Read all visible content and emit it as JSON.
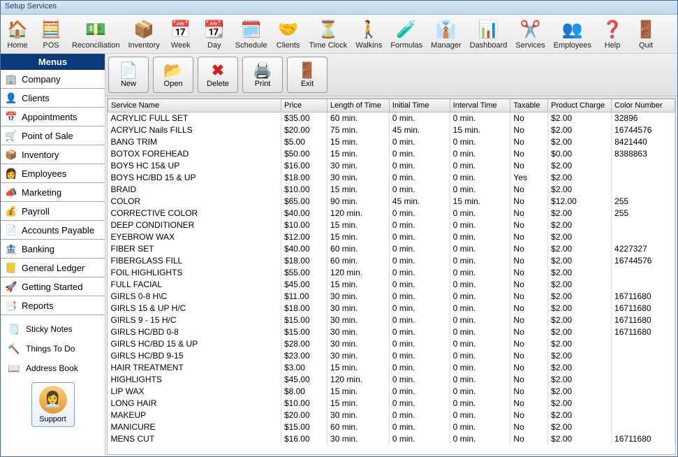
{
  "window": {
    "title": "Setup Services"
  },
  "toolbar": [
    {
      "name": "home",
      "label": "Home",
      "icon": "🏠"
    },
    {
      "name": "pos",
      "label": "POS",
      "icon": "🧮"
    },
    {
      "name": "reconciliation",
      "label": "Reconciliation",
      "icon": "💵"
    },
    {
      "name": "inventory",
      "label": "Inventory",
      "icon": "📦"
    },
    {
      "name": "week",
      "label": "Week",
      "icon": "📅"
    },
    {
      "name": "day",
      "label": "Day",
      "icon": "📆"
    },
    {
      "name": "schedule",
      "label": "Schedule",
      "icon": "🗓️"
    },
    {
      "name": "clients",
      "label": "Clients",
      "icon": "🤝"
    },
    {
      "name": "timeclock",
      "label": "Time Clock",
      "icon": "⏳"
    },
    {
      "name": "walkins",
      "label": "Walkins",
      "icon": "🚶"
    },
    {
      "name": "formulas",
      "label": "Formulas",
      "icon": "🧪"
    },
    {
      "name": "manager",
      "label": "Manager",
      "icon": "👔"
    },
    {
      "name": "dashboard",
      "label": "Dashboard",
      "icon": "📊"
    },
    {
      "name": "services",
      "label": "Services",
      "icon": "✂️"
    },
    {
      "name": "employees",
      "label": "Employees",
      "icon": "👥"
    },
    {
      "name": "help",
      "label": "Help",
      "icon": "❓"
    },
    {
      "name": "quit",
      "label": "Quit",
      "icon": "🚪"
    }
  ],
  "sidebar": {
    "header": "Menus",
    "items": [
      {
        "name": "company",
        "label": "Company",
        "icon": "🏢"
      },
      {
        "name": "clients",
        "label": "Clients",
        "icon": "👤"
      },
      {
        "name": "appointments",
        "label": "Appointments",
        "icon": "📅"
      },
      {
        "name": "pos",
        "label": "Point of Sale",
        "icon": "🛒"
      },
      {
        "name": "inventory",
        "label": "Inventory",
        "icon": "📦"
      },
      {
        "name": "employees",
        "label": "Employees",
        "icon": "👩"
      },
      {
        "name": "marketing",
        "label": "Marketing",
        "icon": "📣"
      },
      {
        "name": "payroll",
        "label": "Payroll",
        "icon": "💰"
      },
      {
        "name": "accounts-payable",
        "label": "Accounts Payable",
        "icon": "📄"
      },
      {
        "name": "banking",
        "label": "Banking",
        "icon": "🏦"
      },
      {
        "name": "general-ledger",
        "label": "General Ledger",
        "icon": "📒"
      },
      {
        "name": "getting-started",
        "label": "Getting Started",
        "icon": "🚀"
      },
      {
        "name": "reports",
        "label": "Reports",
        "icon": "📑"
      }
    ],
    "utils": [
      {
        "name": "sticky-notes",
        "label": "Sticky Notes",
        "icon": "🗒️"
      },
      {
        "name": "things-to-do",
        "label": "Things To Do",
        "icon": "🔨"
      },
      {
        "name": "address-book",
        "label": "Address Book",
        "icon": "📖"
      }
    ],
    "support": {
      "label": "Support"
    }
  },
  "actions": [
    {
      "name": "new",
      "label": "New",
      "icon": "📄"
    },
    {
      "name": "open",
      "label": "Open",
      "icon": "📂"
    },
    {
      "name": "delete",
      "label": "Delete",
      "icon": "✖"
    },
    {
      "name": "print",
      "label": "Print",
      "icon": "🖨️"
    },
    {
      "name": "exit",
      "label": "Exit",
      "icon": "🚪"
    }
  ],
  "table": {
    "headers": [
      "Service Name",
      "Price",
      "Length of Time",
      "Initial Time",
      "Interval Time",
      "Taxable",
      "Product Charge",
      "Color Number"
    ],
    "rows": [
      {
        "name": "ACRYLIC FULL SET",
        "price": "$35.00",
        "len": "60 min.",
        "init": "0 min.",
        "intv": "0 min.",
        "tax": "No",
        "prod": "$2.00",
        "color": "32896"
      },
      {
        "name": "ACRYLIC Nails FILLS",
        "price": "$20.00",
        "len": "75 min.",
        "init": "45 min.",
        "intv": "15 min.",
        "tax": "No",
        "prod": "$2.00",
        "color": "16744576"
      },
      {
        "name": "BANG TRIM",
        "price": "$5.00",
        "len": "15 min.",
        "init": "0 min.",
        "intv": "0 min.",
        "tax": "No",
        "prod": "$2.00",
        "color": "8421440"
      },
      {
        "name": "BOTOX FOREHEAD",
        "price": "$50.00",
        "len": "15 min.",
        "init": "0 min.",
        "intv": "0 min.",
        "tax": "No",
        "prod": "$0.00",
        "color": "8388863"
      },
      {
        "name": "BOYS HC 15&  UP",
        "price": "$16.00",
        "len": "30 min.",
        "init": "0 min.",
        "intv": "0 min.",
        "tax": "No",
        "prod": "$2.00",
        "color": ""
      },
      {
        "name": "BOYS HC/BD 15 & UP",
        "price": "$18.00",
        "len": "30 min.",
        "init": "0 min.",
        "intv": "0 min.",
        "tax": "Yes",
        "prod": "$2.00",
        "color": ""
      },
      {
        "name": "BRAID",
        "price": "$10.00",
        "len": "15 min.",
        "init": "0 min.",
        "intv": "0 min.",
        "tax": "No",
        "prod": "$2.00",
        "color": ""
      },
      {
        "name": "COLOR",
        "price": "$65.00",
        "len": "90 min.",
        "init": "45 min.",
        "intv": "15 min.",
        "tax": "No",
        "prod": "$12.00",
        "color": "255"
      },
      {
        "name": "CORRECTIVE COLOR",
        "price": "$40.00",
        "len": "120 min.",
        "init": "0 min.",
        "intv": "0 min.",
        "tax": "No",
        "prod": "$2.00",
        "color": "255"
      },
      {
        "name": "DEEP CONDITIONER",
        "price": "$10.00",
        "len": "15 min.",
        "init": "0 min.",
        "intv": "0 min.",
        "tax": "No",
        "prod": "$2.00",
        "color": ""
      },
      {
        "name": "EYEBROW WAX",
        "price": "$12.00",
        "len": "15 min.",
        "init": "0 min.",
        "intv": "0 min.",
        "tax": "No",
        "prod": "$2.00",
        "color": ""
      },
      {
        "name": "FIBER SET",
        "price": "$40.00",
        "len": "60 min.",
        "init": "0 min.",
        "intv": "0 min.",
        "tax": "No",
        "prod": "$2.00",
        "color": "4227327"
      },
      {
        "name": "FIBERGLASS FILL",
        "price": "$18.00",
        "len": "60 min.",
        "init": "0 min.",
        "intv": "0 min.",
        "tax": "No",
        "prod": "$2.00",
        "color": "16744576"
      },
      {
        "name": "FOIL HIGHLIGHTS",
        "price": "$55.00",
        "len": "120 min.",
        "init": "0 min.",
        "intv": "0 min.",
        "tax": "No",
        "prod": "$2.00",
        "color": ""
      },
      {
        "name": "FULL FACIAL",
        "price": "$45.00",
        "len": "15 min.",
        "init": "0 min.",
        "intv": "0 min.",
        "tax": "No",
        "prod": "$2.00",
        "color": ""
      },
      {
        "name": "GIRLS 0-8 H\\C",
        "price": "$11.00",
        "len": "30 min.",
        "init": "0 min.",
        "intv": "0 min.",
        "tax": "No",
        "prod": "$2.00",
        "color": "16711680"
      },
      {
        "name": "GIRLS 15 &  UP H/C",
        "price": "$18.00",
        "len": "30 min.",
        "init": "0 min.",
        "intv": "0 min.",
        "tax": "No",
        "prod": "$2.00",
        "color": "16711680"
      },
      {
        "name": "GIRLS 9 - 15 H/C",
        "price": "$15.00",
        "len": "30 min.",
        "init": "0 min.",
        "intv": "0 min.",
        "tax": "No",
        "prod": "$2.00",
        "color": "16711680"
      },
      {
        "name": "GIRLS HC/BD 0-8",
        "price": "$15.00",
        "len": "30 min.",
        "init": "0 min.",
        "intv": "0 min.",
        "tax": "No",
        "prod": "$2.00",
        "color": "16711680"
      },
      {
        "name": "GIRLS HC/BD 15 & UP",
        "price": "$28.00",
        "len": "30 min.",
        "init": "0 min.",
        "intv": "0 min.",
        "tax": "No",
        "prod": "$2.00",
        "color": ""
      },
      {
        "name": "GIRLS HC/BD 9-15",
        "price": "$23.00",
        "len": "30 min.",
        "init": "0 min.",
        "intv": "0 min.",
        "tax": "No",
        "prod": "$2.00",
        "color": ""
      },
      {
        "name": "HAIR TREATMENT",
        "price": "$3.00",
        "len": "15 min.",
        "init": "0 min.",
        "intv": "0 min.",
        "tax": "No",
        "prod": "$2.00",
        "color": ""
      },
      {
        "name": "HIGHLIGHTS",
        "price": "$45.00",
        "len": "120 min.",
        "init": "0 min.",
        "intv": "0 min.",
        "tax": "No",
        "prod": "$2.00",
        "color": ""
      },
      {
        "name": "LIP WAX",
        "price": "$8.00",
        "len": "15 min.",
        "init": "0 min.",
        "intv": "0 min.",
        "tax": "No",
        "prod": "$2.00",
        "color": ""
      },
      {
        "name": "LONG HAIR",
        "price": "$10.00",
        "len": "15 min.",
        "init": "0 min.",
        "intv": "0 min.",
        "tax": "No",
        "prod": "$2.00",
        "color": ""
      },
      {
        "name": "MAKEUP",
        "price": "$20.00",
        "len": "30 min.",
        "init": "0 min.",
        "intv": "0 min.",
        "tax": "No",
        "prod": "$2.00",
        "color": ""
      },
      {
        "name": "MANICURE",
        "price": "$15.00",
        "len": "60 min.",
        "init": "0 min.",
        "intv": "0 min.",
        "tax": "No",
        "prod": "$2.00",
        "color": ""
      },
      {
        "name": "MENS CUT",
        "price": "$16.00",
        "len": "30 min.",
        "init": "0 min.",
        "intv": "0 min.",
        "tax": "No",
        "prod": "$2.00",
        "color": "16711680"
      }
    ]
  }
}
